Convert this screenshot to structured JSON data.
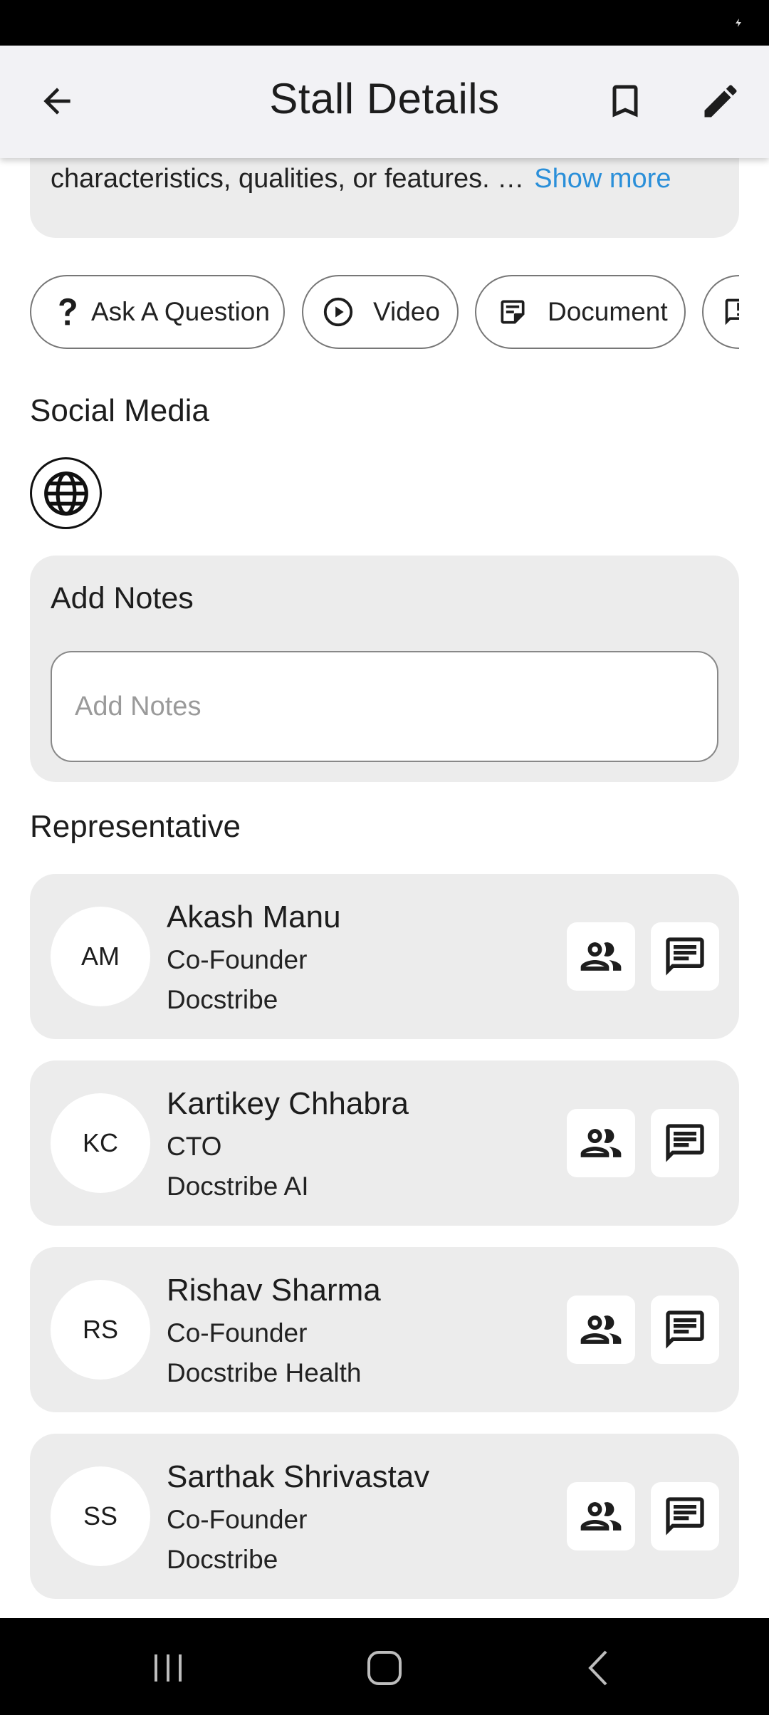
{
  "header": {
    "title": "Stall Details"
  },
  "description": {
    "text": "characteristics, qualities, or features. …",
    "show_more": "Show more"
  },
  "actions": [
    {
      "label": "Ask A Question",
      "icon": "question-icon"
    },
    {
      "label": "Video",
      "icon": "play-circle-icon"
    },
    {
      "label": "Document",
      "icon": "document-icon"
    },
    {
      "label": "",
      "icon": "feedback-icon"
    }
  ],
  "social": {
    "title": "Social Media",
    "icons": [
      "globe-icon"
    ]
  },
  "notes": {
    "title": "Add Notes",
    "placeholder": "Add Notes",
    "value": ""
  },
  "representatives": {
    "title": "Representative",
    "items": [
      {
        "initials": "AM",
        "name": "Akash Manu",
        "role": "Co-Founder",
        "org": "Docstribe"
      },
      {
        "initials": "KC",
        "name": "Kartikey Chhabra",
        "role": "CTO",
        "org": "Docstribe AI"
      },
      {
        "initials": "RS",
        "name": "Rishav Sharma",
        "role": "Co-Founder",
        "org": "Docstribe Health"
      },
      {
        "initials": "SS",
        "name": "Sarthak Shrivastav",
        "role": "Co-Founder",
        "org": "Docstribe"
      }
    ]
  },
  "colors": {
    "accent_link": "#2a8fd9",
    "card_bg": "#ececec",
    "appbar_bg": "#f2f2f5"
  }
}
